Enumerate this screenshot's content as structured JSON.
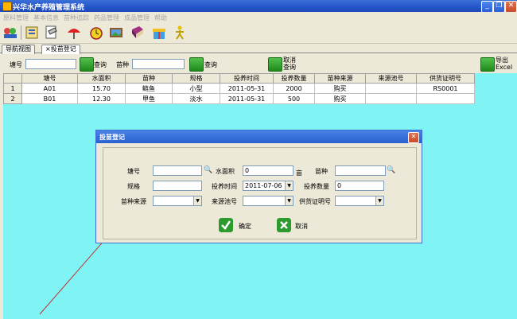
{
  "window": {
    "title": "兴华水产养殖管理系统"
  },
  "menu": [
    "原料管理",
    "基本信息",
    "苗种追踪",
    "药品管理",
    "成品管理",
    "帮助"
  ],
  "tabs": [
    "导航视图",
    "投苗登记"
  ],
  "search": {
    "pond_label": "塘号",
    "query_label_1": "查询",
    "fry_label": "苗种",
    "query_label_2": "查询",
    "cancel_query_label": "取消\n查询",
    "export_label": "导出\nExcel"
  },
  "grid": {
    "columns": [
      "塘号",
      "水面积",
      "苗种",
      "规格",
      "投养时间",
      "投养数量",
      "苗种来源",
      "来源池号",
      "供货证明号"
    ],
    "rows": [
      {
        "num": "1",
        "cells": [
          "A01",
          "15.70",
          "鲢鱼",
          "小型",
          "2011-05-31",
          "2000",
          "购买",
          "",
          "RS0001"
        ]
      },
      {
        "num": "2",
        "cells": [
          "B01",
          "12.30",
          "甲鱼",
          "淡水",
          "2011-05-31",
          "500",
          "购买",
          "",
          ""
        ]
      }
    ]
  },
  "dialog": {
    "title": "投苗登记",
    "pond_label": "塘号",
    "area_label": "水面积",
    "area_value": "0",
    "area_unit": "亩",
    "fry_label": "苗种",
    "spec_label": "规格",
    "time_label": "投养时间",
    "time_value": "2011-07-06",
    "qty_label": "投养数量",
    "qty_value": "0",
    "source_label": "苗种来源",
    "pool_label": "来源池号",
    "cert_label": "供货证明号",
    "ok_label": "确定",
    "cancel_label": "取消"
  },
  "colors": {
    "grid_bg": "#80f4f4",
    "titlebar": "#2454c8"
  }
}
